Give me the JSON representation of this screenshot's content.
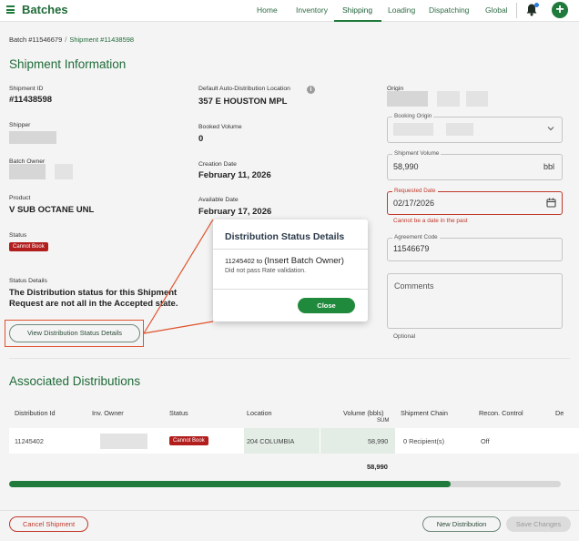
{
  "app": {
    "title": "Batches"
  },
  "nav": {
    "tabs": [
      "Home",
      "Inventory",
      "Shipping",
      "Loading",
      "Dispatching",
      "Global"
    ],
    "active_tab": "Shipping"
  },
  "icons": {
    "menu": "hamburger-icon",
    "bell": "bell-icon",
    "add": "plus-icon",
    "info": "info-icon",
    "calendar": "calendar-icon",
    "chevron": "chevron-down-icon"
  },
  "colors": {
    "brand": "#1f7a3c",
    "danger": "#b21e1e",
    "annotation": "#e0522b"
  },
  "breadcrumb": {
    "batch": "Batch #11546679",
    "separator": "/",
    "shipment": "Shipment #11438598"
  },
  "shipment_info": {
    "title": "Shipment Information",
    "shipment_id_label": "Shipment ID",
    "shipment_id": "#11438598",
    "shipper_label": "Shipper",
    "batch_owner_label": "Batch Owner",
    "product_label": "Product",
    "product": "V SUB OCTANE UNL",
    "status_label": "Status",
    "status": "Cannot Book",
    "status_details_label": "Status Details",
    "status_details": "The Distribution status for this Shipment Request are not all in the Accepted state.",
    "view_details_button": "View Distribution Status Details",
    "default_location_label": "Default Auto-Distribution Location",
    "default_location": "357 E HOUSTON MPL",
    "booked_volume_label": "Booked Volume",
    "booked_volume": "0",
    "creation_date_label": "Creation Date",
    "creation_date": "February 11, 2026",
    "available_date_label": "Available Date",
    "available_date": "February 17, 2026",
    "origin_label": "Origin",
    "booking_origin_label": "Booking Origin",
    "shipment_volume_label": "Shipment Volume",
    "shipment_volume": "58,990",
    "shipment_volume_unit": "bbl",
    "requested_date_label": "Requested Date",
    "requested_date": "02/17/2026",
    "requested_date_error": "Cannot be a date in the past",
    "agreement_code_label": "Agreement Code",
    "agreement_code": "11546679",
    "comments_label": "Comments",
    "optional_label": "Optional"
  },
  "distributions": {
    "title": "Associated Distributions",
    "columns": [
      "Distribution Id",
      "Inv. Owner",
      "Status",
      "Location",
      "Volume (bbls)",
      "Shipment Chain",
      "Recon. Control",
      "De"
    ],
    "sum_label": "SUM",
    "rows": [
      {
        "id": "11245402",
        "status": "Cannot Book",
        "location": "204 COLUMBIA",
        "volume": "58,990",
        "chain": "0 Recipient(s)",
        "recon": "Off"
      }
    ],
    "total": "58,990",
    "progress_fraction": 0.8
  },
  "footer": {
    "cancel": "Cancel Shipment",
    "new_distribution": "New Distribution",
    "save": "Save Changes"
  },
  "modal": {
    "title": "Distribution Status Details",
    "dist_id": "11245402 to",
    "annotation": "(Insert Batch Owner)",
    "message": "Did not pass Rate validation.",
    "close": "Close"
  }
}
